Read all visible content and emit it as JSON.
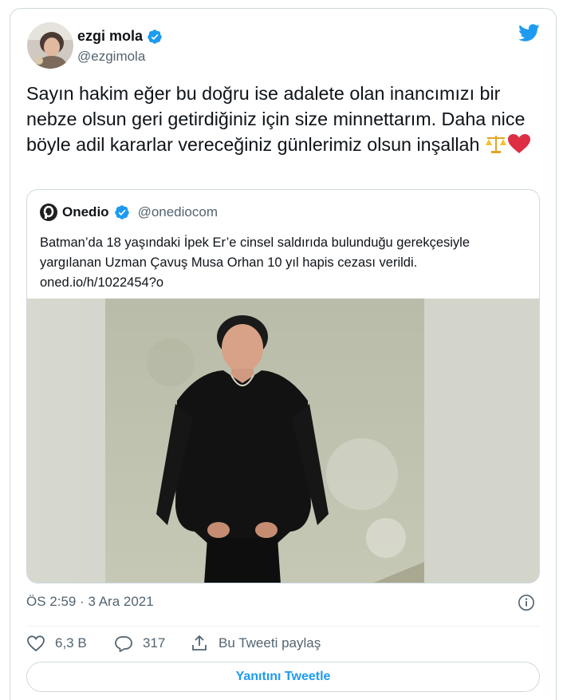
{
  "author": {
    "name": "ezgi mola",
    "handle": "@ezgimola"
  },
  "tweet": {
    "text": "Sayın hakim eğer bu doğru ise adalete olan inancımızı bir nebze olsun geri getirdiğiniz için size minnettarım. Daha nice böyle adil kararlar vereceğiniz günlerimiz olsun inşallah",
    "emojis": [
      "scales-emoji",
      "red-heart-emoji"
    ]
  },
  "quote": {
    "name": "Onedio",
    "handle": "@onediocom",
    "text_line1": "Batman’da 18 yaşındaki İpek Er’e cinsel saldırıda bulunduğu gerekçesiyle",
    "text_line2": "yargılanan Uzman Çavuş Musa Orhan 10 yıl hapis cezası verildi.",
    "link": "oned.io/h/1022454?o"
  },
  "meta": {
    "timestamp": "ÖS 2:59 · 3 Ara 2021"
  },
  "actions": {
    "likes": "6,3 B",
    "replies": "317",
    "share_label": "Bu Tweeti paylaş"
  },
  "reply_button": "Yanıtını Tweetle",
  "colors": {
    "accent": "#1d9bf0",
    "secondary_text": "#536471",
    "border": "#cfd9de"
  }
}
